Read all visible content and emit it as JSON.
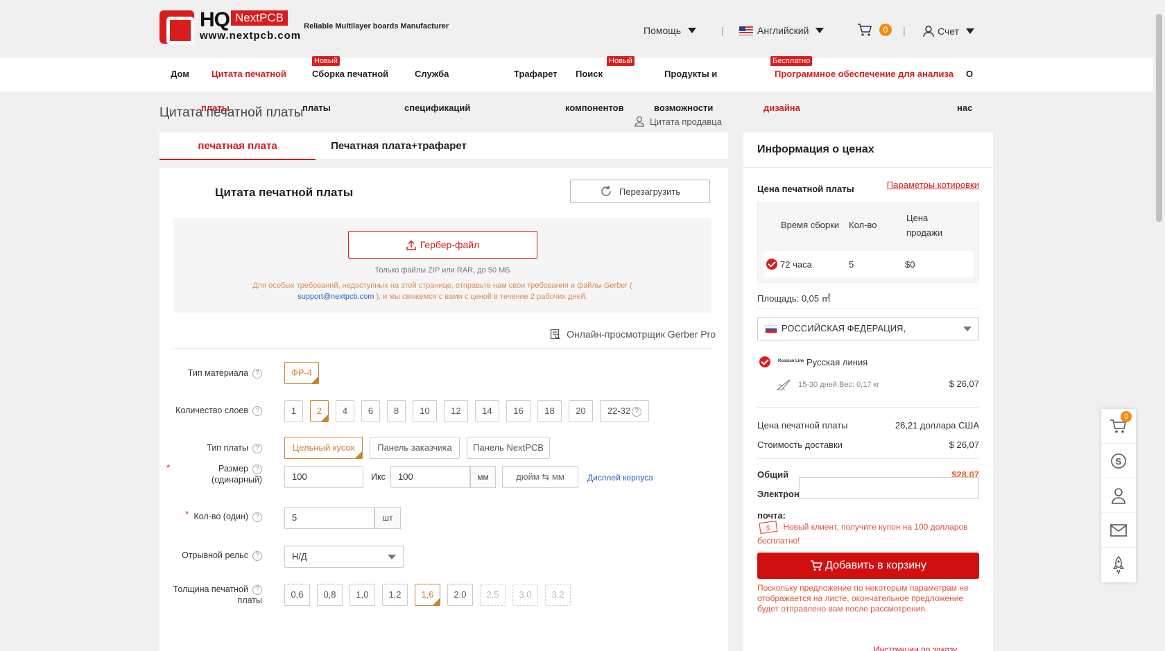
{
  "header": {
    "logo_hq": "HQ",
    "logo_badge": "NextPCB",
    "logo_url": "www.nextpcb.com",
    "tagline": "Reliable Multilayer boards Manufacturer",
    "help": "Помощь",
    "language": "Английский",
    "cart_count": "0",
    "account": "Счет"
  },
  "nav": {
    "home": "Дом",
    "pcb_quote_line1": "Цитата печатной",
    "pcb_quote_line2": "платы",
    "assembly_line1": "Сборка печатной",
    "assembly_line2": "платы",
    "assembly_badge": "Новый",
    "service_line1": "Служба",
    "service_line2": "спецификаций",
    "stencil": "Трафарет",
    "search_line1": "Поиск",
    "search_line2": "компонентов",
    "search_badge": "Новый",
    "products_line1": "Продукты и",
    "products_line2": "возможности",
    "software_line1": "Программное обеспечение для анализа",
    "software_line2": "дизайна",
    "software_badge": "Бесплатно",
    "about_line1": "О",
    "about_line2": "нас"
  },
  "page": {
    "title": "Цитата печатной платы",
    "seller_quote": "Цитата продавца"
  },
  "tabs": [
    "печатная плата",
    "Печатная плата+трафарет"
  ],
  "quote": {
    "title": "Цитата печатной платы",
    "reload": "Перезагрузить",
    "gerber_button": "Гербер-файл",
    "upload_note": "Только файлы ZIP или RAR, до 50 МБ",
    "hint_part1": "Для особых требований, недоступных на этой странице, отправьте нам свои требования и файлы Gerber (",
    "hint_email": "support@nextpcb.com",
    "hint_part2": "), и мы свяжемся с вами с ценой в течение 2 рабочих дней.",
    "viewer": "Онлайн-просмотрщик Gerber Pro"
  },
  "form": {
    "material_label": "Тип материала",
    "material_value": "ФР-4",
    "layers_label": "Количество слоев",
    "layers": [
      "1",
      "2",
      "4",
      "6",
      "8",
      "10",
      "12",
      "14",
      "16",
      "18",
      "20",
      "22-32"
    ],
    "layers_selected": "2",
    "board_type_label": "Тип платы",
    "board_types": [
      "Цельный кусок",
      "Панель заказчика",
      "Панель NextPCB"
    ],
    "size_label_line1": "Размер",
    "size_label_line2": "(одинарный)",
    "size_x": "100",
    "size_x_sep": "Икс",
    "size_y": "100",
    "size_unit": "мм",
    "unit_toggle_left": "дюйм",
    "unit_toggle_right": "мм",
    "case_display": "Дисплей корпуса",
    "qty_label": "Кол-во (один)",
    "qty_value": "5",
    "qty_unit": "шт",
    "rail_label": "Отрывной рельс",
    "rail_value": "Н/Д",
    "thickness_label_line1": "Толщина печатной",
    "thickness_label_line2": "платы",
    "thickness": [
      "0,6",
      "0,8",
      "1,0",
      "1,2",
      "1,6",
      "2.0",
      "2.5",
      "3.0",
      "3.2"
    ],
    "thickness_selected": "1,6"
  },
  "price_info": {
    "title": "Информация о ценах",
    "pcb_price_label": "Цена печатной платы",
    "quote_params": "Параметры котировки",
    "col_build_time": "Время сборки",
    "col_qty": "Кол-во",
    "col_price_line1": "Цена",
    "col_price_line2": "продажи",
    "row_build_time": "72 часа",
    "row_qty": "5",
    "row_price": "$0",
    "area": "Площадь: 0,05 ㎡",
    "country": "РОССИЙСКАЯ ФЕДЕРАЦИЯ,",
    "shipping_logo": "Russian Line",
    "shipping_name": "Русская линия",
    "shipping_detail": "15-30 дней,Вес: 0,17 кг",
    "shipping_price": "$ 26,07",
    "pcb_cost_label": "Цена печатной платы",
    "pcb_cost_value": "26,21 доллара США",
    "shipping_cost_label": "Стоимость доставки",
    "shipping_cost_value": "$ 26,07",
    "total_label": "Общий",
    "total_value": "$28,07",
    "email_label_line1": "Электронная",
    "email_label_line2": "почта:",
    "coupon": "Новый клиент, получите купон на 100 долларов бесплатно!",
    "add_to_cart": "Добавить в корзину",
    "cart_note": "Поскольку предложение по некоторым параметрам не отображается на листе, окончательное предложение будет отправлено вам после рассмотрения.",
    "cart_note_more": "Инструкции по заказу"
  },
  "float_bar": {
    "cart_count": "0"
  },
  "colors": {
    "brand_red": "#d91c1c",
    "selected_gold": "#c8852f",
    "link_blue": "#2a62c9",
    "badge_orange": "#f28a12"
  }
}
